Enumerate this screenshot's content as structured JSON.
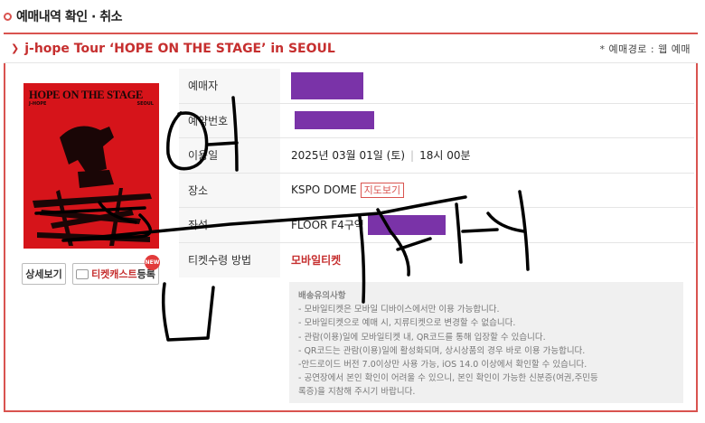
{
  "header": {
    "title": "예매내역 확인 · 취소"
  },
  "performance": {
    "title": "j-hope Tour ‘HOPE ON THE STAGE’ in SEOUL",
    "route": "* 예매경로 : 웹 예매"
  },
  "poster": {
    "title": "HOPE ON THE STAGE",
    "artist": "J-HOPE",
    "city": "SEOUL"
  },
  "buttons": {
    "detail": "상세보기",
    "ticketcast_strong": "티켓캐스트",
    "ticketcast": "등록",
    "new_badge": "NEW"
  },
  "booking": {
    "rows": [
      {
        "label": "예매자",
        "value": ""
      },
      {
        "label": "예약번호",
        "value": ""
      },
      {
        "label": "이용일",
        "date": "2025년 03월 01일 (토)",
        "time": "18시 00분"
      },
      {
        "label": "장소",
        "venue": "KSPO DOME",
        "map_link": "지도보기"
      },
      {
        "label": "좌석",
        "seat": "FLOOR F4구역"
      },
      {
        "label": "티켓수령 방법",
        "value": "모바일티켓"
      }
    ]
  },
  "notice": {
    "title": "배송유의사항",
    "items": [
      "- 모바일티켓은 모바일 디바이스에서만 이용 가능합니다.",
      "- 모바일티켓으로 예매 시, 지류티켓으로 변경할 수 없습니다.",
      "- 관람(이용)일에 모바일티켓 내, QR코드를 통해 입장할 수 있습니다.",
      "- QR코드는 관람(이용)일에 활성화되며, 상시상품의 경우 바로 이용 가능합니다.",
      "-안드로이드 버전 7.0이상만 사용 가능, iOS 14.0 이상에서 확인할 수 있습니다.",
      "- 공연장에서 본인 확인이 어려울 수 있으니, 본인 확인이 가능한 신분증(여권,주민등",
      "록증)을 지참해 주시기 바랍니다."
    ]
  },
  "colors": {
    "accent": "#d9534f",
    "redaction": "#7a33a8",
    "poster": "#d6141a"
  }
}
